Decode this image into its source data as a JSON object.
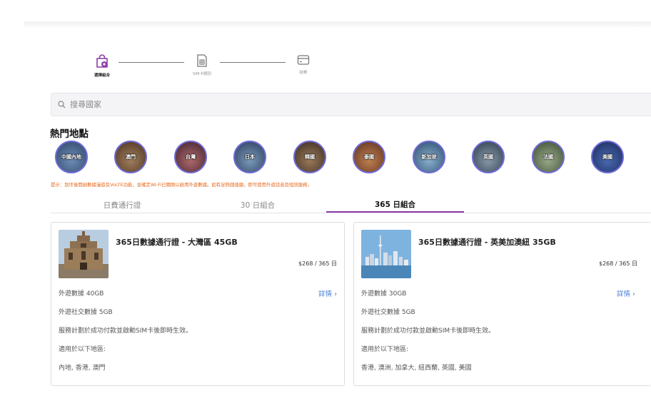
{
  "stepper": {
    "steps": [
      {
        "label": "選擇組合",
        "icon": "bag-plus-icon",
        "active": true
      },
      {
        "label": "SIM卡類別",
        "icon": "sim-card-icon",
        "active": false
      },
      {
        "label": "結帳",
        "icon": "payment-card-icon",
        "active": false
      }
    ]
  },
  "search": {
    "placeholder": "搜尋國家",
    "icon": "search-icon"
  },
  "popular": {
    "title": "熱門地點",
    "destinations": [
      {
        "label": "中國內地",
        "color": "#5b7aa6"
      },
      {
        "label": "澳門",
        "color": "#8a6a4a"
      },
      {
        "label": "台灣",
        "color": "#7a4a5a"
      },
      {
        "label": "日本",
        "color": "#4a6a8a"
      },
      {
        "label": "韓國",
        "color": "#6a5a4a"
      },
      {
        "label": "泰國",
        "color": "#8a5a3a"
      },
      {
        "label": "新加坡",
        "color": "#5a7a9a"
      },
      {
        "label": "英國",
        "color": "#5a6a7a"
      },
      {
        "label": "法國",
        "color": "#6a7a5a"
      },
      {
        "label": "美國",
        "color": "#3a4a8a"
      }
    ]
  },
  "tip": "提示：到埗後開啟數據漫遊及VoLTE功能，並確定Wi-Fi已關閉以啟用外遊數據。如有足夠儲值額，即可使用外遊話音及短訊服務。",
  "tabs": [
    {
      "label": "日費通行證",
      "active": false
    },
    {
      "label": "30 日組合",
      "active": false
    },
    {
      "label": "365 日組合",
      "active": true
    }
  ],
  "cards": [
    {
      "title": "365日數據通行證 - 大灣區 45GB",
      "price": "$268 / 365 日",
      "data": "外遊數據 40GB",
      "details": "詳情",
      "social": "外遊社交數據 5GB",
      "note": "服務計劃於成功付款並啟動SIM卡後即時生效。",
      "applies_label": "適用於以下地區:",
      "regions": "內地, 香港, 澳門"
    },
    {
      "title": "365日數據通行證 - 英美加澳紐 35GB",
      "price": "$268 / 365 日",
      "data": "外遊數據 30GB",
      "details": "詳情",
      "social": "外遊社交數據 5GB",
      "note": "服務計劃於成功付款並啟動SIM卡後即時生效。",
      "applies_label": "適用於以下地區:",
      "regions": "香港, 澳洲, 加拿大, 紐西蘭, 英國, 美國"
    }
  ],
  "colors": {
    "accent": "#8c3aa8",
    "tip": "#e66a1d",
    "link": "#4a7fd6",
    "ring": "#6f6ad6"
  }
}
